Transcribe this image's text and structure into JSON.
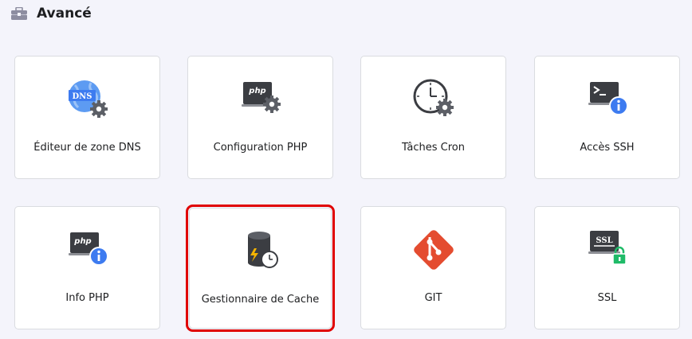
{
  "section": {
    "title": "Avancé",
    "icon": "toolbox-icon"
  },
  "cards": [
    {
      "label": "Éditeur de zone DNS",
      "icon": "dns-gear-icon"
    },
    {
      "label": "Configuration PHP",
      "icon": "php-gear-icon"
    },
    {
      "label": "Tâches Cron",
      "icon": "clock-gear-icon"
    },
    {
      "label": "Accès SSH",
      "icon": "terminal-info-icon"
    },
    {
      "label": "Info PHP",
      "icon": "php-info-icon"
    },
    {
      "label": "Gestionnaire de Cache",
      "icon": "cache-database-icon",
      "highlighted": true
    },
    {
      "label": "GIT",
      "icon": "git-icon"
    },
    {
      "label": "SSL",
      "icon": "ssl-lock-icon"
    }
  ],
  "colors": {
    "highlight": "#e00000",
    "accent_blue": "#3d7bf0",
    "git_orange": "#e44c30",
    "lock_green": "#1fbb68"
  }
}
